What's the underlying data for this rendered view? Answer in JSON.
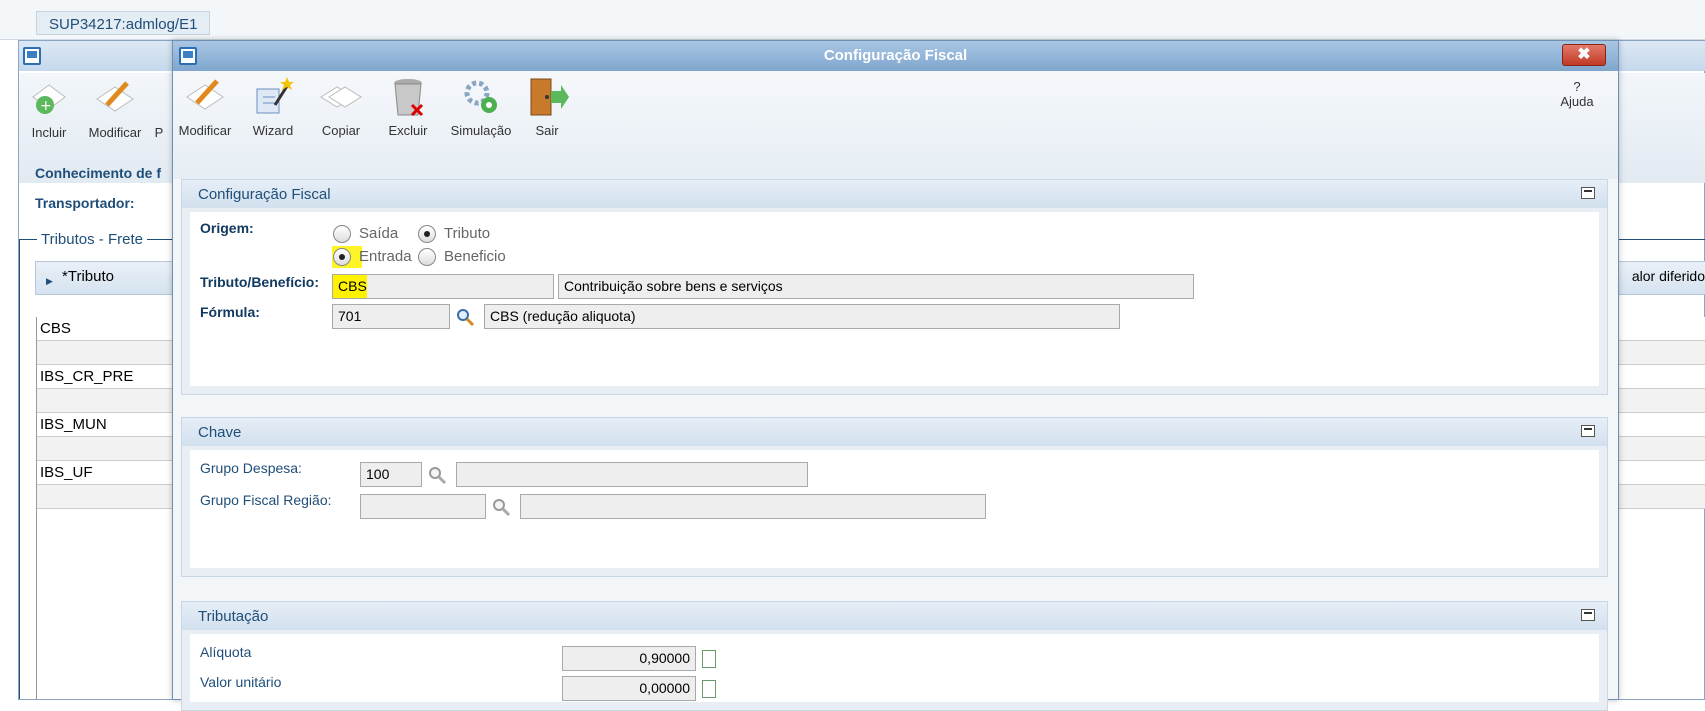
{
  "tab": {
    "label": "SUP34217:admlog/E1"
  },
  "bg_window": {
    "toolbar": [
      {
        "label": "Incluir",
        "icon": "add-icon"
      },
      {
        "label": "Modificar",
        "icon": "pencil-icon"
      },
      {
        "label": "P",
        "icon": ""
      }
    ],
    "conhecimento_label": "Conhecimento de f",
    "transportador_label": "Transportador:",
    "section_title": "Tributos - Frete",
    "grid_header": "*Tributo",
    "grid_header_right": "alor diferido",
    "rows": [
      "CBS",
      "",
      "IBS_CR_PRE",
      "",
      "IBS_MUN",
      "",
      "IBS_UF",
      ""
    ]
  },
  "modal": {
    "title": "Configuração Fiscal",
    "close_label": "✖",
    "toolbar": [
      {
        "label": "Modificar",
        "icon": "pencil-icon"
      },
      {
        "label": "Wizard",
        "icon": "wizard-icon"
      },
      {
        "label": "Copiar",
        "icon": "copy-icon"
      },
      {
        "label": "Excluir",
        "icon": "trash-icon"
      },
      {
        "label": "Simulação",
        "icon": "gears-icon"
      },
      {
        "label": "Sair",
        "icon": "exit-door-icon"
      }
    ],
    "help_label": "Ajuda",
    "config_panel": {
      "title": "Configuração Fiscal",
      "origem_label": "Origem:",
      "radio_saida": "Saída",
      "radio_tributo": "Tributo",
      "radio_entrada": "Entrada",
      "radio_beneficio": "Beneficio",
      "tributo_label": "Tributo/Benefício:",
      "tributo_code": "CBS",
      "tributo_desc": "Contribuição sobre bens e serviços",
      "formula_label": "Fórmula:",
      "formula_code": "701",
      "formula_desc": "CBS (redução aliquota)"
    },
    "chave_panel": {
      "title": "Chave",
      "grupo_despesa_label": "Grupo Despesa:",
      "grupo_despesa_value": "100",
      "grupo_despesa_desc": "",
      "grupo_fiscal_label": "Grupo Fiscal Região:",
      "grupo_fiscal_value": "",
      "grupo_fiscal_desc": ""
    },
    "tributacao_panel": {
      "title": "Tributação",
      "aliquota_label": "Alíquota",
      "aliquota_value": "0,90000",
      "valor_unitario_label": "Valor unitário",
      "valor_unitario_value": "0,00000"
    }
  },
  "colors": {
    "header_blue": "#1f4e79",
    "highlight": "#fff200",
    "close_red": "#c03a24"
  }
}
